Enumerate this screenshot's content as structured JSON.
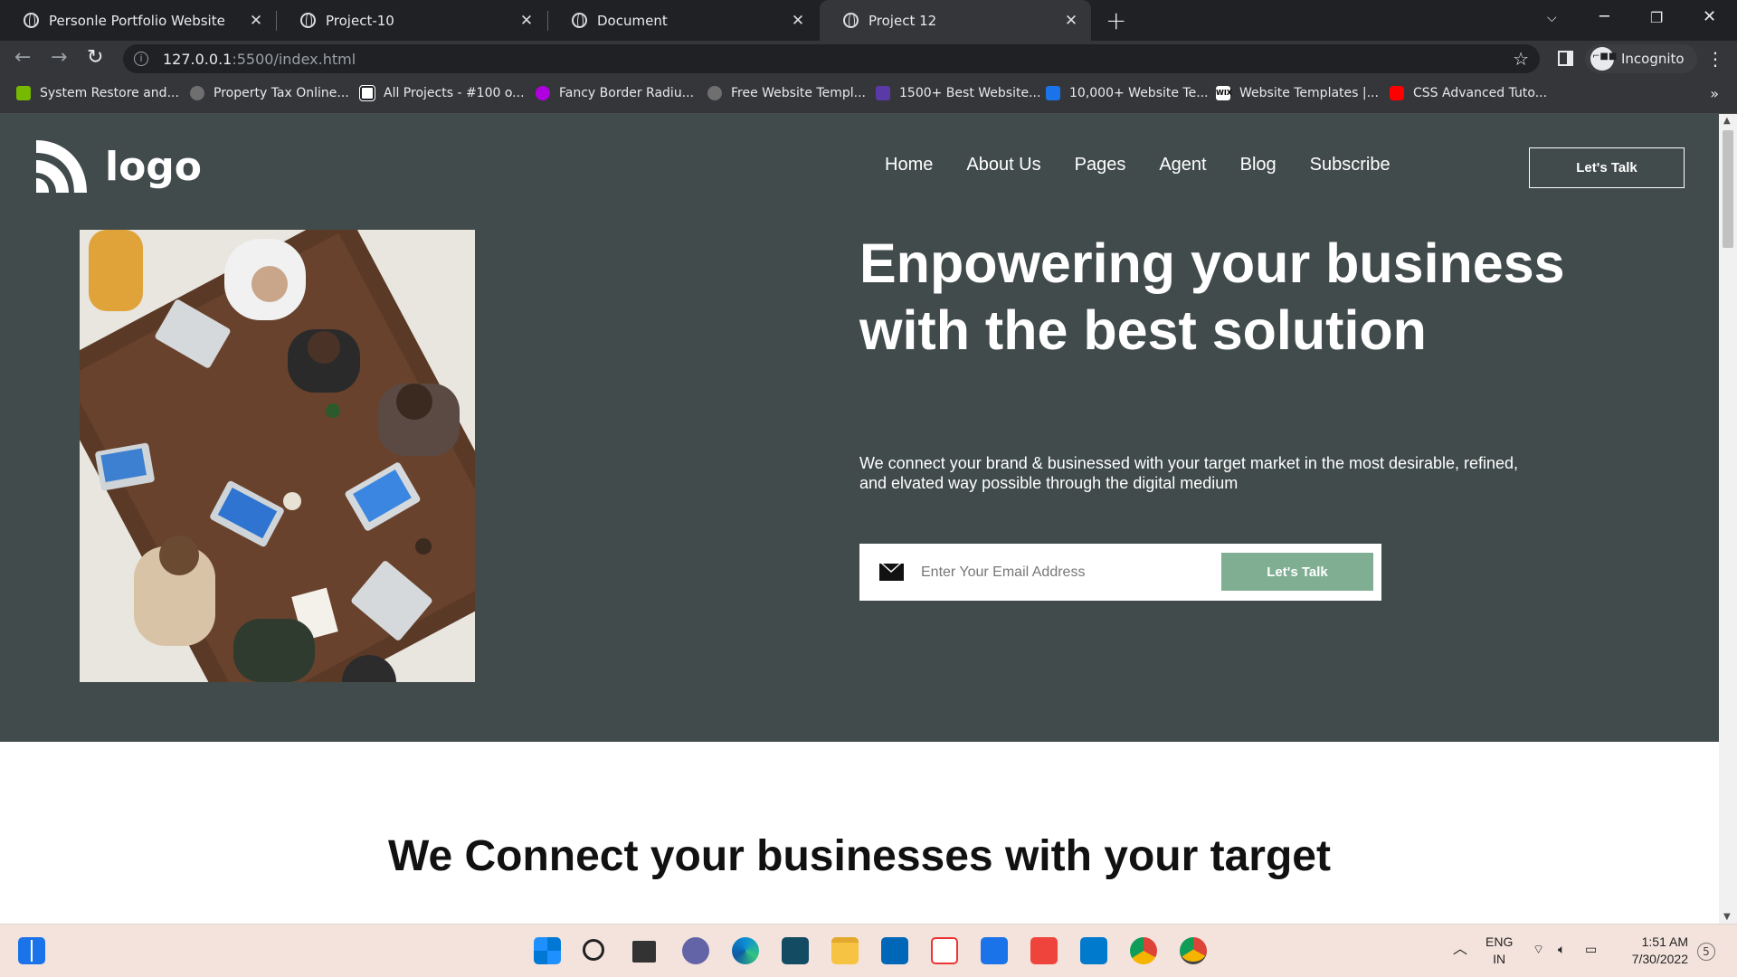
{
  "browser": {
    "tabs": [
      {
        "label": "Personle Portfolio Website",
        "active": false
      },
      {
        "label": "Project-10",
        "active": false
      },
      {
        "label": "Document",
        "active": false
      },
      {
        "label": "Project 12",
        "active": true
      }
    ],
    "url_host": "127.0.0.1",
    "url_path": ":5500/index.html",
    "profile_label": "Incognito",
    "bookmarks": [
      {
        "label": "System Restore and...",
        "color": "#76b900"
      },
      {
        "label": "Property Tax Online...",
        "color": "#6f6f6f"
      },
      {
        "label": "All Projects - #100 o...",
        "color": "#ffffff"
      },
      {
        "label": "Fancy Border Radiu...",
        "color": "#b000e0"
      },
      {
        "label": "Free Website Templ...",
        "color": "#6f6f6f"
      },
      {
        "label": "1500+ Best Website...",
        "color": "#5a3aa6"
      },
      {
        "label": "10,000+ Website Te...",
        "color": "#1a73e8"
      },
      {
        "label": "Website Templates |...",
        "color": "#ffffff"
      },
      {
        "label": "CSS Advanced Tuto...",
        "color": "#ff0000"
      }
    ]
  },
  "page": {
    "logo_text": "logo",
    "nav": [
      "Home",
      "About Us",
      "Pages",
      "Agent",
      "Blog",
      "Subscribe"
    ],
    "header_cta": "Let's Talk",
    "headline": "Enpowering your business with the best solution",
    "subtext": "We connect your brand & businessed with your target market in the most desirable, refined, and elvated way possible through the digital medium",
    "email_placeholder": "Enter Your Email Address",
    "email_cta": "Let's Talk",
    "section2_title": "We Connect your businesses with your target",
    "colors": {
      "hero_bg": "#414b4b",
      "accent": "#7fae92"
    }
  },
  "taskbar": {
    "language": "ENG",
    "region": "IN",
    "time": "1:51 AM",
    "date": "7/30/2022",
    "notifications": "5",
    "apps": [
      "start-icon",
      "search-icon",
      "task-view-icon",
      "teams-chat-icon",
      "edge-icon",
      "sublime-icon",
      "file-explorer-icon",
      "store-icon",
      "gift-icon",
      "mail-icon",
      "anydesk-icon",
      "vscode-icon",
      "chrome-icon",
      "chrome-profile-icon"
    ]
  }
}
